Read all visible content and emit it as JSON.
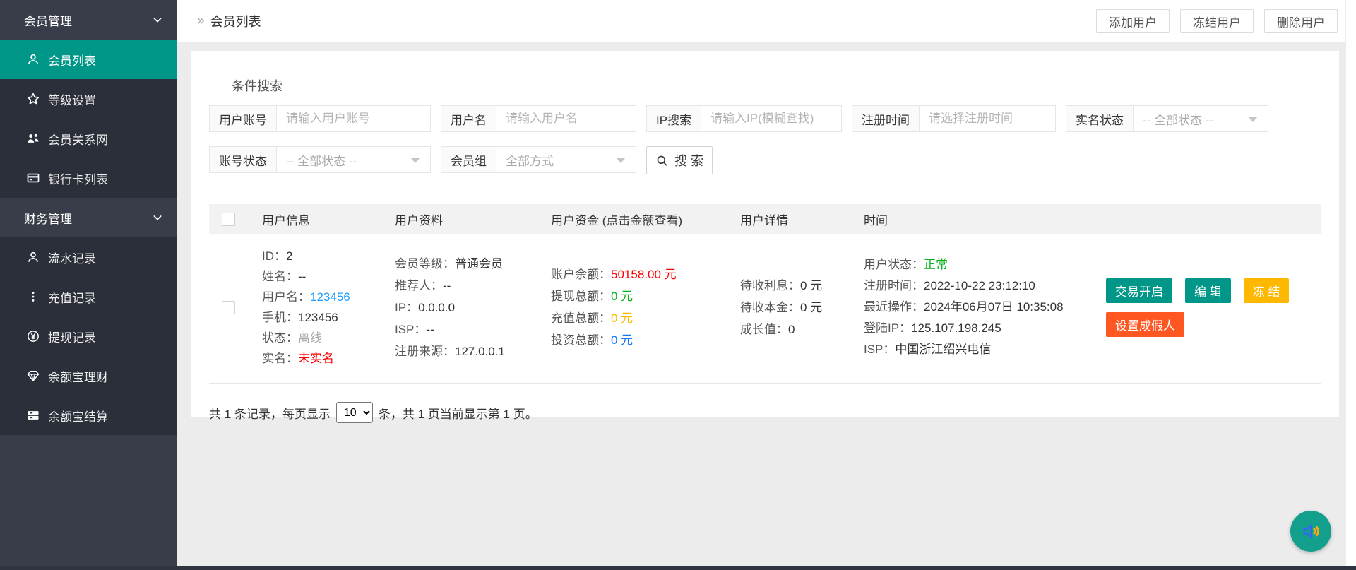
{
  "colors": {
    "accent_teal": "#009688",
    "warning_yellow": "#FFB800",
    "danger_orange": "#FF5722",
    "link_blue": "#1E9FFF",
    "value_red": "#FF0000",
    "value_green": "#00B018",
    "value_blue": "#1677FF",
    "sidebar_dark": "#383D49",
    "sidebar_child_dark": "#2B2F3A"
  },
  "sidebar": {
    "groups": [
      {
        "label": "会员管理",
        "items": [
          {
            "label": "会员列表",
            "icon": "user-icon",
            "active": true
          },
          {
            "label": "等级设置",
            "icon": "star-icon",
            "active": false
          },
          {
            "label": "会员关系网",
            "icon": "users-icon",
            "active": false
          },
          {
            "label": "银行卡列表",
            "icon": "bank-card-icon",
            "active": false
          }
        ]
      },
      {
        "label": "财务管理",
        "items": [
          {
            "label": "流水记录",
            "icon": "user-icon",
            "active": false
          },
          {
            "label": "充值记录",
            "icon": "dots-icon",
            "active": false
          },
          {
            "label": "提现记录",
            "icon": "yen-circle-icon",
            "active": false
          },
          {
            "label": "余额宝理财",
            "icon": "diamond-icon",
            "active": false
          },
          {
            "label": "余额宝结算",
            "icon": "server-icon",
            "active": false
          }
        ]
      }
    ]
  },
  "topbar": {
    "breadcrumb_separator": "»",
    "breadcrumb_title": "会员列表",
    "buttons": {
      "add_user": "添加用户",
      "freeze_user": "冻结用户",
      "delete_user": "删除用户"
    }
  },
  "search": {
    "legend": "条件搜索",
    "fields": {
      "account": {
        "label": "用户账号",
        "placeholder": "请输入用户账号"
      },
      "username": {
        "label": "用户名",
        "placeholder": "请输入用户名"
      },
      "ip": {
        "label": "IP搜索",
        "placeholder": "请输入IP(模糊查找)"
      },
      "reg_time": {
        "label": "注册时间",
        "placeholder": "请选择注册时间"
      },
      "realname_status": {
        "label": "实名状态",
        "value": "-- 全部状态 --"
      },
      "account_status": {
        "label": "账号状态",
        "value": "-- 全部状态 --"
      },
      "member_group": {
        "label": "会员组",
        "value": "全部方式"
      }
    },
    "search_button": "搜 索"
  },
  "table": {
    "headers": {
      "user_info": "用户信息",
      "user_profile": "用户资料",
      "user_funds": "用户资金 (点击金额查看)",
      "user_details": "用户详情",
      "time": "时间"
    },
    "row": {
      "user_info": [
        {
          "k": "ID：",
          "v": "2"
        },
        {
          "k": "姓名：",
          "v": "--"
        },
        {
          "k": "用户名：",
          "v": "123456"
        },
        {
          "k": "手机：",
          "v": "123456"
        },
        {
          "k": "状态：",
          "v": "离线"
        },
        {
          "k": "实名：",
          "v": "未实名"
        }
      ],
      "user_profile": [
        {
          "k": "会员等级：",
          "v": "普通会员"
        },
        {
          "k": "推荐人：",
          "v": "--"
        },
        {
          "k": "IP：",
          "v": "0.0.0.0"
        },
        {
          "k": "ISP：",
          "v": "--"
        },
        {
          "k": "注册来源：",
          "v": "127.0.0.1"
        }
      ],
      "user_funds": [
        {
          "k": "账户余额：",
          "v": "50158.00 元"
        },
        {
          "k": "提现总额：",
          "v": "0 元"
        },
        {
          "k": "充值总额：",
          "v": "0 元"
        },
        {
          "k": "投资总额：",
          "v": "0 元"
        }
      ],
      "user_details": [
        {
          "k": "待收利息：",
          "v": "0 元"
        },
        {
          "k": "待收本金：",
          "v": "0 元"
        },
        {
          "k": "成长值：",
          "v": "0"
        }
      ],
      "time": [
        {
          "k": "用户状态：",
          "v": "正常"
        },
        {
          "k": "注册时间：",
          "v": "2022-10-22 23:12:10"
        },
        {
          "k": "最近操作：",
          "v": "2024年06月07日 10:35:08"
        },
        {
          "k": "登陆IP：",
          "v": "125.107.198.245"
        },
        {
          "k": "ISP：",
          "v": "中国浙江绍兴电信"
        }
      ],
      "actions": {
        "trade_open": "交易开启",
        "edit": "编 辑",
        "freeze": "冻 结",
        "set_fake": "设置成假人"
      }
    }
  },
  "pagination": {
    "prefix": "共 1 条记录，每页显示",
    "page_size": "10",
    "suffix": "条，共 1 页当前显示第 1 页。"
  }
}
